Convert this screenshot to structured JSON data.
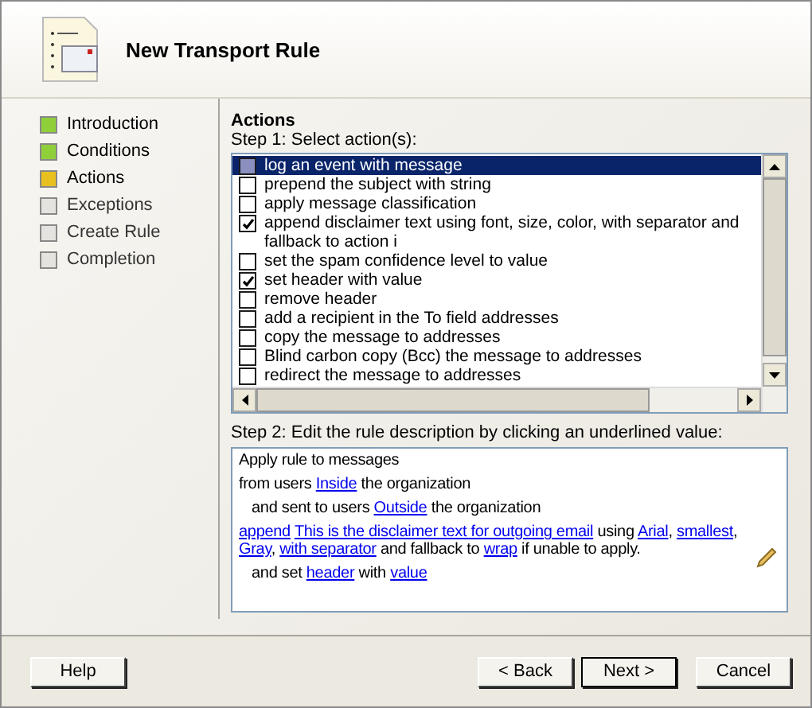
{
  "window": {
    "title": "New Transport Rule"
  },
  "steps": [
    {
      "label": "Introduction",
      "kind": "done"
    },
    {
      "label": "Conditions",
      "kind": "done"
    },
    {
      "label": "Actions",
      "kind": "current"
    },
    {
      "label": "Exceptions",
      "kind": "pending"
    },
    {
      "label": "Create Rule",
      "kind": "pending"
    },
    {
      "label": "Completion",
      "kind": "pending"
    }
  ],
  "section_title": "Actions",
  "step1_label": "Step 1: Select action(s):",
  "actions": [
    {
      "label": "log an event with message",
      "checked": false,
      "selected": true
    },
    {
      "label": "prepend the subject with string",
      "checked": false,
      "selected": false
    },
    {
      "label": "apply message classification",
      "checked": false,
      "selected": false
    },
    {
      "label": "append disclaimer text using font, size, color, with separator and fallback to action i",
      "checked": true,
      "selected": false
    },
    {
      "label": "set the spam confidence level to value",
      "checked": false,
      "selected": false
    },
    {
      "label": "set header with value",
      "checked": true,
      "selected": false
    },
    {
      "label": "remove header",
      "checked": false,
      "selected": false
    },
    {
      "label": "add a recipient in the To field addresses",
      "checked": false,
      "selected": false
    },
    {
      "label": "copy the message to addresses",
      "checked": false,
      "selected": false
    },
    {
      "label": "Blind carbon copy (Bcc) the message to addresses",
      "checked": false,
      "selected": false
    },
    {
      "label": "redirect the message to addresses",
      "checked": false,
      "selected": false
    }
  ],
  "step2_label": "Step 2: Edit the rule description by clicking an underlined value:",
  "description": [
    {
      "kind": "plain",
      "segments": [
        {
          "kind": "text",
          "text": "Apply rule to messages"
        }
      ]
    },
    {
      "kind": "plain",
      "segments": [
        {
          "kind": "text",
          "text": "from users "
        },
        {
          "kind": "link",
          "text": "Inside"
        },
        {
          "kind": "text",
          "text": " the organization"
        }
      ]
    },
    {
      "kind": "indented",
      "segments": [
        {
          "kind": "text",
          "text": "and sent to users "
        },
        {
          "kind": "link",
          "text": "Outside"
        },
        {
          "kind": "text",
          "text": " the organization"
        }
      ]
    },
    {
      "kind": "plain",
      "segments": [
        {
          "kind": "link",
          "text": "append"
        },
        {
          "kind": "link",
          "text": "This is the disclaimer text for outgoing email"
        },
        {
          "kind": "text",
          "text": " using "
        },
        {
          "kind": "link",
          "text": "Arial"
        },
        {
          "kind": "text",
          "text": ", "
        },
        {
          "kind": "link",
          "text": "smallest"
        },
        {
          "kind": "text",
          "text": ", "
        },
        {
          "kind": "link",
          "text": "Gray"
        },
        {
          "kind": "text",
          "text": ", "
        },
        {
          "kind": "link",
          "text": "with separator"
        },
        {
          "kind": "text",
          "text": " and fallback to "
        },
        {
          "kind": "link",
          "text": "wrap"
        },
        {
          "kind": "text",
          "text": " if unable to apply."
        }
      ]
    },
    {
      "kind": "indented",
      "segments": [
        {
          "kind": "text",
          "text": "and set "
        },
        {
          "kind": "link",
          "text": "header"
        },
        {
          "kind": "text",
          "text": " with "
        },
        {
          "kind": "link",
          "text": "value"
        }
      ]
    }
  ],
  "buttons": {
    "help": "Help",
    "back": "< Back",
    "next": "Next >",
    "cancel": "Cancel"
  }
}
